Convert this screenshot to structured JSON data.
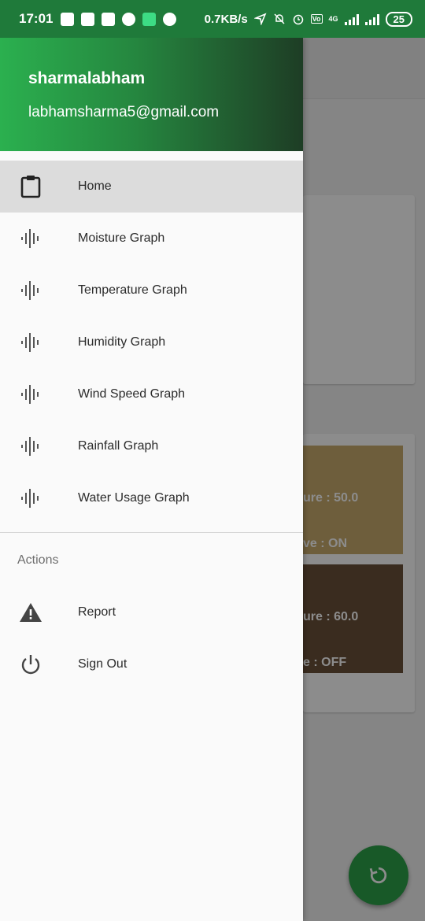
{
  "status_bar": {
    "time": "17:01",
    "net_speed": "0.7KB/s",
    "network_label": "4G",
    "battery": "25"
  },
  "background": {
    "tile1": {
      "line1": "ure : 50.0",
      "line2": "ve : ON",
      "color": "#c8ac6e"
    },
    "tile2": {
      "line1": "ure : 60.0",
      "line2": "e : OFF",
      "color": "#6b5139"
    },
    "fab_icon": "refresh-icon"
  },
  "drawer": {
    "header": {
      "username": "sharmalabham",
      "email": "labhamsharma5@gmail.com"
    },
    "items": [
      {
        "label": "Home",
        "icon": "clipboard-icon",
        "active": true
      },
      {
        "label": "Moisture Graph",
        "icon": "waveform-icon"
      },
      {
        "label": "Temperature Graph",
        "icon": "waveform-icon"
      },
      {
        "label": "Humidity Graph",
        "icon": "waveform-icon"
      },
      {
        "label": "Wind Speed Graph",
        "icon": "waveform-icon"
      },
      {
        "label": "Rainfall Graph",
        "icon": "waveform-icon"
      },
      {
        "label": "Water Usage Graph",
        "icon": "waveform-icon"
      }
    ],
    "actions_title": "Actions",
    "actions": [
      {
        "label": "Report",
        "icon": "warning-icon"
      },
      {
        "label": "Sign Out",
        "icon": "power-icon"
      }
    ]
  },
  "colors": {
    "header_start": "#2bb04f",
    "header_end": "#1e3d25",
    "accent": "#2ca24a"
  }
}
